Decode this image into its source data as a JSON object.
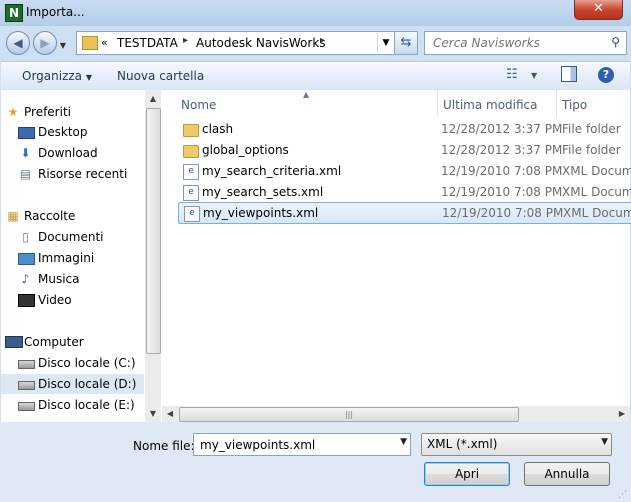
{
  "window": {
    "title": "Importa...",
    "app_icon_letter": "N",
    "close_glyph": "✕"
  },
  "address": {
    "overflow_glyph": "«",
    "crumbs": [
      "TESTDATA",
      "Autodesk NavisWorks"
    ],
    "separator": "▸"
  },
  "search": {
    "placeholder": "Cerca Navisworks"
  },
  "toolbar": {
    "organize_label": "Organizza",
    "new_folder_label": "Nuova cartella"
  },
  "nav": {
    "favorites_label": "Preferiti",
    "favorites": [
      "Desktop",
      "Download",
      "Risorse recenti"
    ],
    "libraries_label": "Raccolte",
    "libraries": [
      "Documenti",
      "Immagini",
      "Musica",
      "Video"
    ],
    "computer_label": "Computer",
    "drives": [
      "Disco locale (C:)",
      "Disco locale (D:)",
      "Disco locale (E:)"
    ]
  },
  "columns": {
    "name": "Nome",
    "modified": "Ultima modifica",
    "type": "Tipo"
  },
  "files": [
    {
      "name": "clash",
      "date": "12/28/2012 3:37 PM",
      "type": "File folder",
      "kind": "folder"
    },
    {
      "name": "global_options",
      "date": "12/28/2012 3:37 PM",
      "type": "File folder",
      "kind": "folder"
    },
    {
      "name": "my_search_criteria.xml",
      "date": "12/19/2010 7:08 PM",
      "type": "XML Document",
      "kind": "xml"
    },
    {
      "name": "my_search_sets.xml",
      "date": "12/19/2010 7:08 PM",
      "type": "XML Document",
      "kind": "xml"
    },
    {
      "name": "my_viewpoints.xml",
      "date": "12/19/2010 7:08 PM",
      "type": "XML Document",
      "kind": "xml"
    }
  ],
  "filename": {
    "label": "Nome file:",
    "value": "my_viewpoints.xml"
  },
  "filetype": {
    "value": "XML (*.xml)"
  },
  "buttons": {
    "open": "Apri",
    "cancel": "Annulla"
  },
  "colors": {
    "titlebar": "#b3cde9",
    "selection": "#d8e8fa",
    "close": "#c8462f"
  }
}
